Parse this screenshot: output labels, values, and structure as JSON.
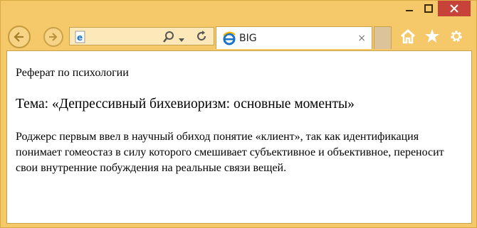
{
  "browser": {
    "tab_title": "BIG",
    "tab_close": "×",
    "caption": {
      "minimize": "minimize",
      "maximize": "maximize",
      "close": "close"
    },
    "accent": "#f3c262",
    "close_color": "#c7433a"
  },
  "document": {
    "label": "Реферат по психологии",
    "topic": "Тема: «Депрессивный бихевиоризм: основные моменты»",
    "paragraph": "Роджерс первым ввел в научный обиход понятие «клиент», так как идентификация понимает гомеостаз в силу которого смешивает субъективное и объективное, переносит свои внутренние побуждения на реальные связи вещей."
  }
}
